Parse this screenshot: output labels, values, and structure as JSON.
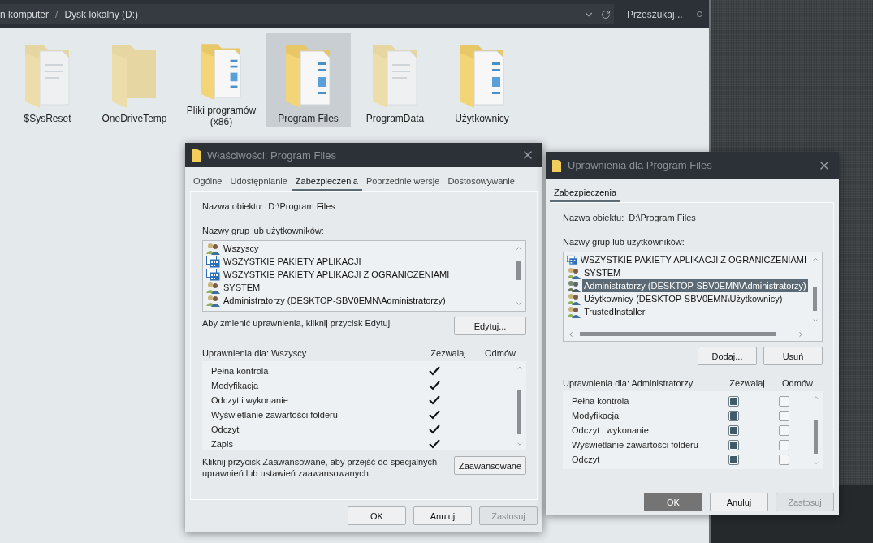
{
  "explorer": {
    "breadcrumb": [
      {
        "label": "n komputer"
      },
      {
        "label": "Dysk lokalny (D:)"
      }
    ],
    "separator": "/",
    "search": {
      "placeholder": "Przeszukaj..."
    },
    "items": [
      {
        "label": "$SysReset",
        "kind": "files",
        "hidden": true,
        "selected": false
      },
      {
        "label": "OneDriveTemp",
        "kind": "empty",
        "hidden": true,
        "selected": false
      },
      {
        "label": "Pliki programów (x86)",
        "kind": "images",
        "hidden": false,
        "selected": false
      },
      {
        "label": "Program Files",
        "kind": "images",
        "hidden": false,
        "selected": true
      },
      {
        "label": "ProgramData",
        "kind": "files",
        "hidden": true,
        "selected": false
      },
      {
        "label": "Użytkownicy",
        "kind": "images",
        "hidden": false,
        "selected": false
      }
    ]
  },
  "properties_dialog": {
    "title": "Właściwości: Program Files",
    "checkboxes": false,
    "tabs": [
      {
        "label": "Ogólne",
        "selected": false
      },
      {
        "label": "Udostępnianie",
        "selected": false
      },
      {
        "label": "Zabezpieczenia",
        "selected": true
      },
      {
        "label": "Poprzednie wersje",
        "selected": false
      },
      {
        "label": "Dostosowywanie",
        "selected": false
      }
    ],
    "object_label": "Nazwa obiektu:",
    "object_value": "D:\\Program Files",
    "groups_label": "Nazwy grup lub użytkowników:",
    "groups": [
      {
        "name": "Wszyscy",
        "kind": "users",
        "selected": false
      },
      {
        "name": "WSZYSTKIE PAKIETY APLIKACJI",
        "kind": "package",
        "selected": false
      },
      {
        "name": "WSZYSTKIE PAKIETY APLIKACJI Z OGRANICZENIAMI",
        "kind": "package",
        "selected": false
      },
      {
        "name": "SYSTEM",
        "kind": "users",
        "selected": false
      },
      {
        "name": "Administratorzy (DESKTOP-SBV0EMN\\Administratorzy)",
        "kind": "users",
        "selected": false
      }
    ],
    "edit_hint": "Aby zmienić uprawnienia, kliknij przycisk Edytuj.",
    "edit_button": "Edytuj...",
    "permissions_label": "Uprawnienia dla: Wszyscy",
    "allow_heading": "Zezwalaj",
    "deny_heading": "Odmów",
    "permissions": [
      {
        "name": "Pełna kontrola",
        "allow": true,
        "deny": false
      },
      {
        "name": "Modyfikacja",
        "allow": true,
        "deny": false
      },
      {
        "name": "Odczyt i wykonanie",
        "allow": true,
        "deny": false
      },
      {
        "name": "Wyświetlanie zawartości folderu",
        "allow": true,
        "deny": false
      },
      {
        "name": "Odczyt",
        "allow": true,
        "deny": false
      },
      {
        "name": "Zapis",
        "allow": true,
        "deny": false
      }
    ],
    "advanced_hint": "Kliknij przycisk Zaawansowane, aby przejść do specjalnych uprawnień lub ustawień zaawansowanych.",
    "advanced_button": "Zaawansowane",
    "buttons": [
      {
        "label": "OK",
        "default": false,
        "disabled": false
      },
      {
        "label": "Anuluj",
        "default": false,
        "disabled": false
      },
      {
        "label": "Zastosuj",
        "default": false,
        "disabled": true
      }
    ]
  },
  "permissions_dialog": {
    "title": "Uprawnienia dla Program Files",
    "checkboxes": true,
    "tabs": [
      {
        "label": "Zabezpieczenia",
        "selected": true
      }
    ],
    "object_label": "Nazwa obiektu:",
    "object_value": "D:\\Program Files",
    "groups_label": "Nazwy grup lub użytkowników:",
    "groups": [
      {
        "name": "WSZYSTKIE PAKIETY APLIKACJI Z OGRANICZENIAMI",
        "kind": "package",
        "selected": false
      },
      {
        "name": "SYSTEM",
        "kind": "users",
        "selected": false
      },
      {
        "name": "Administratorzy (DESKTOP-SBV0EMN\\Administratorzy)",
        "kind": "users",
        "selected": true
      },
      {
        "name": "Użytkownicy (DESKTOP-SBV0EMN\\Użytkownicy)",
        "kind": "users",
        "selected": false
      },
      {
        "name": "TrustedInstaller",
        "kind": "users",
        "selected": false
      }
    ],
    "group_buttons": [
      "Dodaj...",
      "Usuń"
    ],
    "permissions_label": "Uprawnienia dla: Administratorzy",
    "allow_heading": "Zezwalaj",
    "deny_heading": "Odmów",
    "permissions": [
      {
        "name": "Pełna kontrola",
        "allow": true,
        "deny": false
      },
      {
        "name": "Modyfikacja",
        "allow": true,
        "deny": false
      },
      {
        "name": "Odczyt i wykonanie",
        "allow": true,
        "deny": false
      },
      {
        "name": "Wyświetlanie zawartości folderu",
        "allow": true,
        "deny": false
      },
      {
        "name": "Odczyt",
        "allow": true,
        "deny": false
      }
    ],
    "buttons": [
      {
        "label": "OK",
        "default": true,
        "disabled": false
      },
      {
        "label": "Anuluj",
        "default": false,
        "disabled": false
      },
      {
        "label": "Zastosuj",
        "default": false,
        "disabled": true
      }
    ]
  }
}
